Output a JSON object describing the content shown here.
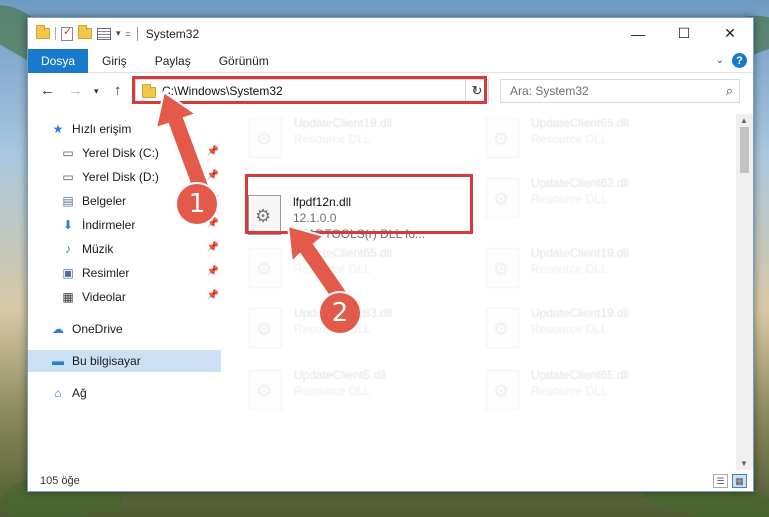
{
  "window": {
    "title": "System32",
    "controls": {
      "minimize": "—",
      "maximize": "☐",
      "close": "✕"
    }
  },
  "ribbon": {
    "tabs": [
      "Dosya",
      "Giriş",
      "Paylaş",
      "Görünüm"
    ],
    "help": "?"
  },
  "navbar": {
    "address": "C:\\Windows\\System32",
    "search_placeholder": "Ara: System32"
  },
  "sidebar": {
    "items": [
      {
        "label": "Hızlı erişim",
        "icon": "star-icon"
      },
      {
        "label": "Yerel Disk (C:)",
        "icon": "drive-icon",
        "pinned": true
      },
      {
        "label": "Yerel Disk (D:)",
        "icon": "drive-icon",
        "pinned": true
      },
      {
        "label": "Belgeler",
        "icon": "documents-icon",
        "pinned": true
      },
      {
        "label": "İndirmeler",
        "icon": "download-icon",
        "pinned": true
      },
      {
        "label": "Müzik",
        "icon": "music-icon",
        "pinned": true
      },
      {
        "label": "Resimler",
        "icon": "pictures-icon",
        "pinned": true
      },
      {
        "label": "Videolar",
        "icon": "videos-icon",
        "pinned": true
      },
      {
        "label": "OneDrive",
        "icon": "cloud-icon"
      },
      {
        "label": "Bu bilgisayar",
        "icon": "computer-icon",
        "selected": true
      },
      {
        "label": "Ağ",
        "icon": "network-icon"
      }
    ]
  },
  "files": {
    "highlighted": {
      "name": "lfpdf12n.dll",
      "version": "12.1.0.0",
      "description": "LEADTOOLS(r) DLL fo..."
    },
    "background": [
      {
        "name": "UpdateClient19.dll",
        "sub": "Resource DLL"
      },
      {
        "name": "UpdateClient65.dll",
        "sub": "Resource DLL"
      },
      {
        "name": "UpdateClient63.dll",
        "sub": "Resource DLL"
      },
      {
        "name": "UpdateClient65.dll",
        "sub": "Resource DLL"
      },
      {
        "name": "UpdateClient19.dll",
        "sub": "Resource DLL"
      },
      {
        "name": "UpdateClient63.dll",
        "sub": "Resource DLL"
      },
      {
        "name": "UpdateClient19.dll",
        "sub": "Resource DLL"
      },
      {
        "name": "UpdateClient5.dll",
        "sub": "Resource DLL"
      },
      {
        "name": "UpdateClient65.dll",
        "sub": "Resource DLL"
      }
    ]
  },
  "status": {
    "count": "105 öğe"
  },
  "annotations": {
    "step1": "1",
    "step2": "2",
    "color": "#d63a3a"
  }
}
